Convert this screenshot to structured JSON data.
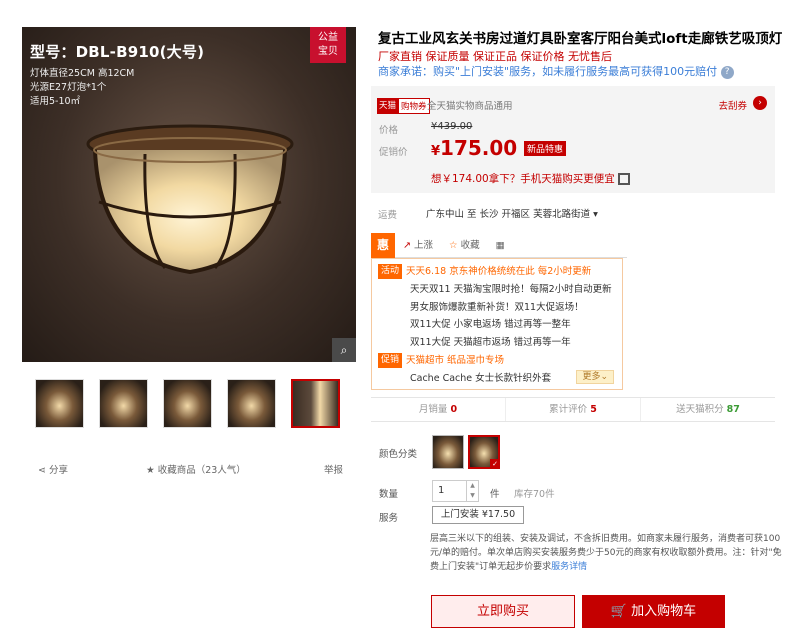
{
  "gallery": {
    "model_label": "型号：DBL-B910(大号)",
    "spec_lines": [
      "灯体直径25CM 高12CM",
      "光源E27灯泡*1个",
      "适用5-10㎡"
    ],
    "badge": [
      "公益",
      "宝贝"
    ],
    "zoom_icon": "magnifier-icon",
    "thumbnail_count": 5,
    "selected_thumbnail": 5
  },
  "share": {
    "share_label": "分享",
    "favorite_label": "收藏商品",
    "popularity": "（23人气）",
    "report_label": "举报"
  },
  "product": {
    "title": "复古工业风玄关书房过道灯具卧室客厅阳台美式loft走廊铁艺吸顶灯",
    "subtitle": "厂家直销 保证质量 保证正品 保证价格 无忧售后",
    "promise": "商家承诺：购买\"上门安装\"服务，如未履行服务最高可获得100元赔付",
    "promise_help": "?"
  },
  "price_box": {
    "tmall_tag": "天猫",
    "shopping_tag": "购物券",
    "coupon_text": "全天猫实物商品通用",
    "coupon_link": "去刮券",
    "coupon_arrow": "›",
    "price_label": "价格",
    "original_price": "¥439.00",
    "promo_label": "促销价",
    "currency": "¥",
    "promo_price": "175.00",
    "sale_tag": "新品特惠",
    "app_price": "想￥174.00拿下？手机天猫购买更便宜"
  },
  "shipping": {
    "label": "运费",
    "value": "广东中山 至 长沙 开福区 芙蓉北路街道 ▾"
  },
  "tools": {
    "hui": "惠",
    "price_up": "上涨",
    "favorite": "收藏",
    "qr": "▦"
  },
  "promos": {
    "activity_tag": "活动",
    "promo_tag": "促销",
    "activity_lines": [
      "天天6.18 京东神价格统统在此 每2小时更新",
      "天天双11 天猫淘宝限时抢！每隔2小时自动更新",
      "男女服饰爆款重新补货！双11大促返场！",
      "双11大促 小家电返场 错过再等一整年",
      "双11大促 天猫超市返场 错过再等一年"
    ],
    "promo_lines": [
      "天猫超市 纸品湿巾专场",
      "Cache Cache 女士长款针织外套"
    ],
    "more_label": "更多⌄"
  },
  "stats": {
    "monthly_sales_label": "月销量",
    "monthly_sales": "0",
    "reviews_label": "累计评价",
    "reviews": "5",
    "points_label": "送天猫积分",
    "points": "87"
  },
  "options": {
    "color_label": "颜色分类",
    "qty_label": "数量",
    "qty_value": "1",
    "qty_unit": "件",
    "stock": "库存70件",
    "service_label": "服务",
    "service_option": "上门安装 ¥17.50",
    "service_desc": "层高三米以下的组装、安装及调试，不含拆旧费用。如商家未履行服务，消费者可获100元/单的赔付。单次单店购买安装服务费少于50元的商家有权收取额外费用。注：针对\"免费上门安装\"订单无起步价要求",
    "service_link": "服务详情"
  },
  "actions": {
    "buy_now": "立即购买",
    "add_to_cart": "加入购物车"
  },
  "colors": {
    "accent": "#c40000",
    "orange": "#ff6600",
    "link": "#3b7ed7"
  }
}
